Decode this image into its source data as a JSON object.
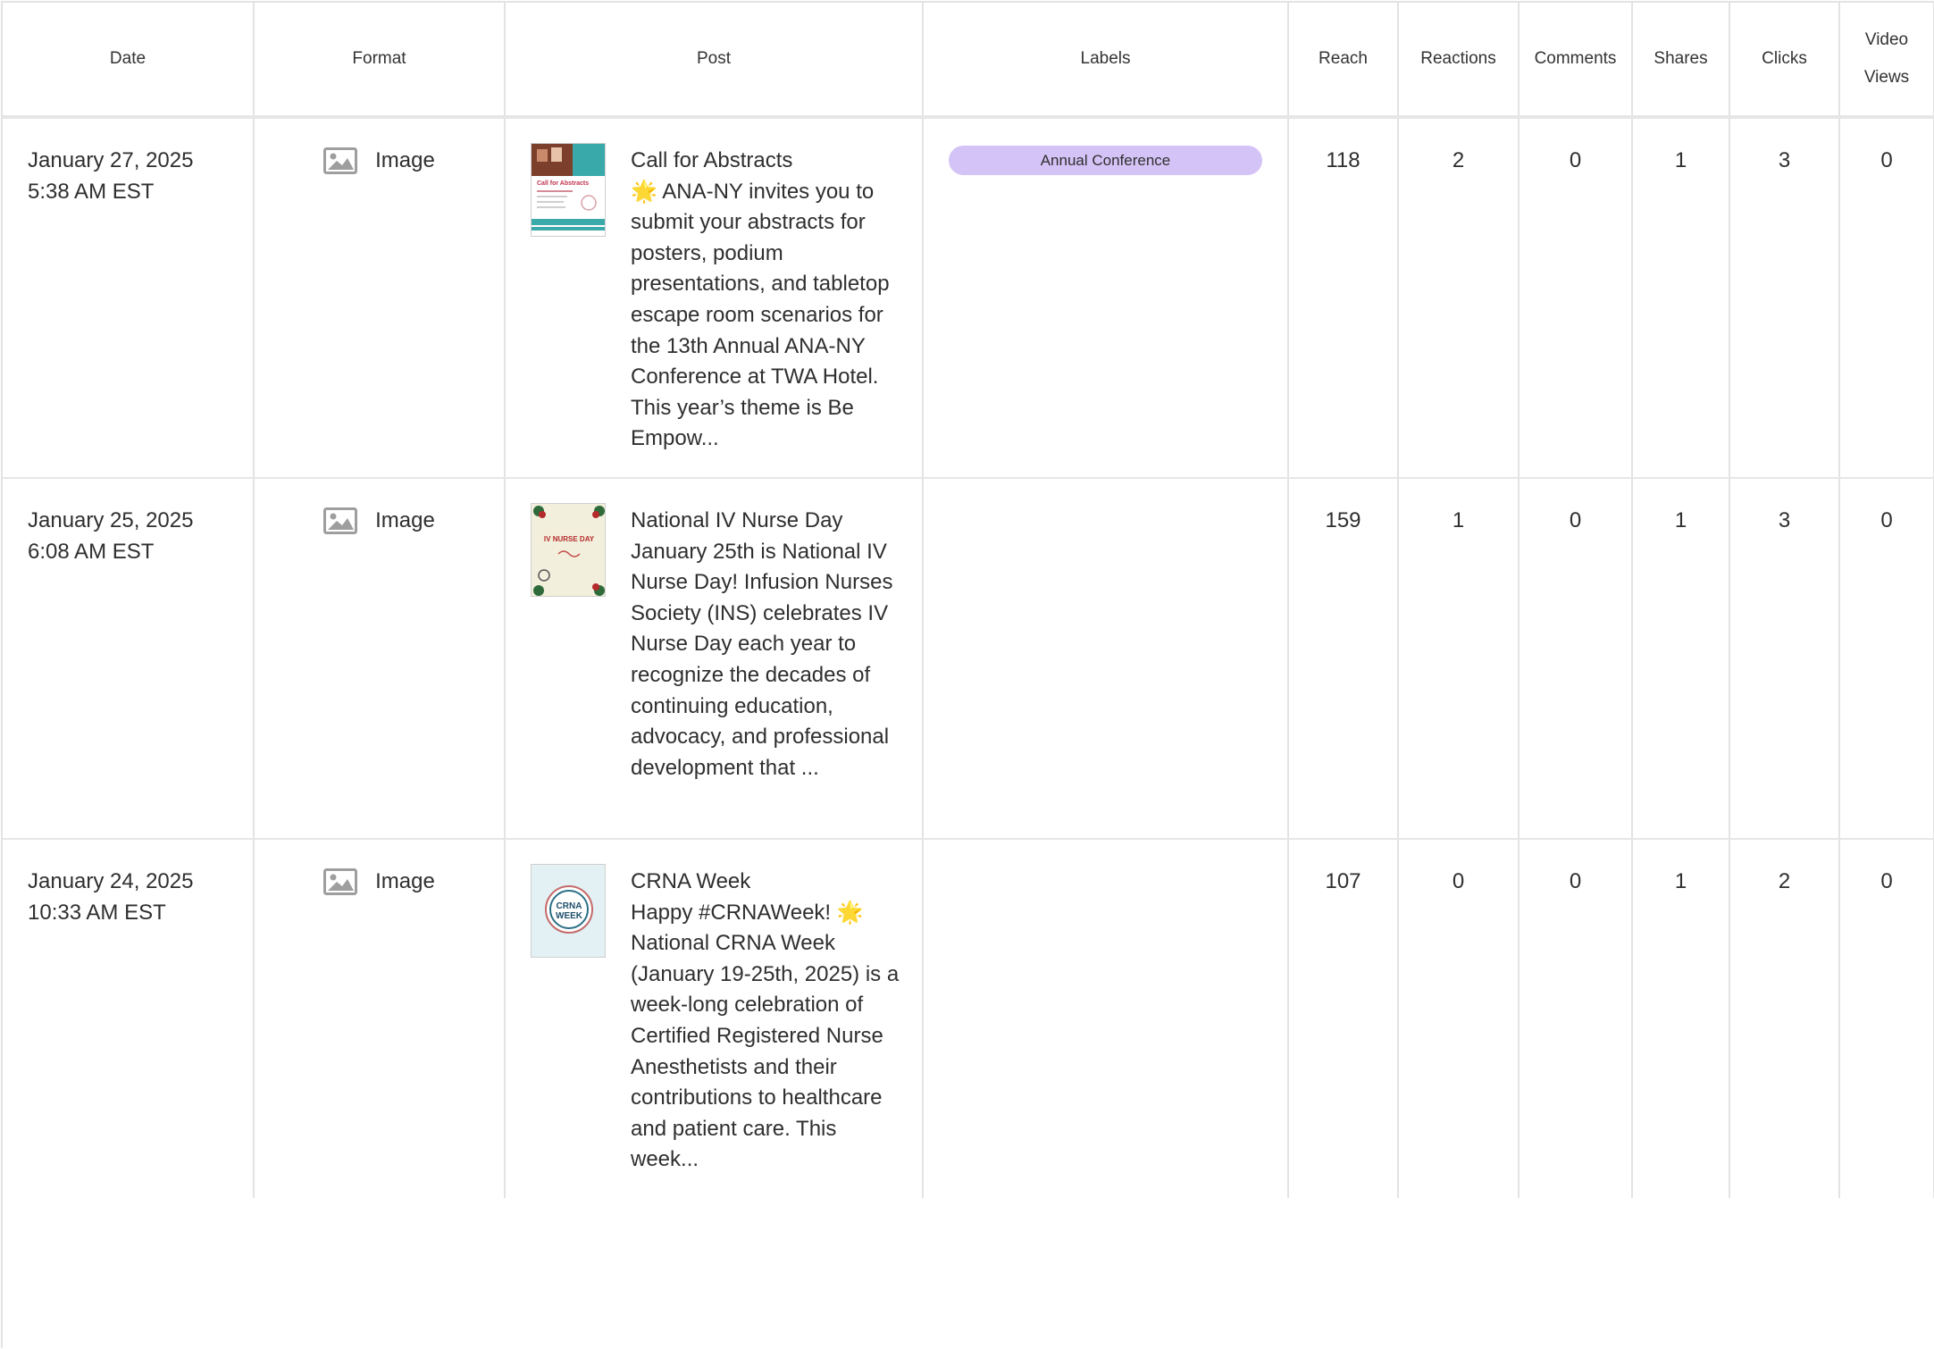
{
  "columns": {
    "date": "Date",
    "format": "Format",
    "post": "Post",
    "labels": "Labels",
    "reach": "Reach",
    "reactions": "Reactions",
    "comments": "Comments",
    "shares": "Shares",
    "clicks": "Clicks",
    "video_views_line1": "Video",
    "video_views_line2": "Views"
  },
  "colors": {
    "label_pill": "#d4c3f6",
    "grid": "#e3e3e3"
  },
  "rows": [
    {
      "date": "January 27, 2025",
      "time": "5:38 AM EST",
      "format": "Image",
      "format_icon": "image-icon",
      "thumbnail": "call-for-abstracts-flyer",
      "post_title": "Call for Abstracts",
      "post_body": "🌟 ANA-NY invites you to submit your abstracts for posters, podium presentations, and tabletop escape room scenarios for the 13th Annual ANA-NY Conference at TWA Hotel. This year’s theme is Be Empow...",
      "label": "Annual Conference",
      "reach": "118",
      "reactions": "2",
      "comments": "0",
      "shares": "1",
      "clicks": "3",
      "video_views": "0"
    },
    {
      "date": "January 25, 2025",
      "time": "6:08 AM EST",
      "format": "Image",
      "format_icon": "image-icon",
      "thumbnail": "iv-nurse-day-card",
      "post_title": "National IV Nurse Day",
      "post_body": "January 25th is National IV Nurse Day! Infusion Nurses Society (INS) celebrates IV Nurse Day each year to recognize the decades of continuing education, advocacy, and professional development that ...",
      "label": "",
      "reach": "159",
      "reactions": "1",
      "comments": "0",
      "shares": "1",
      "clicks": "3",
      "video_views": "0"
    },
    {
      "date": "January 24, 2025",
      "time": "10:33 AM EST",
      "format": "Image",
      "format_icon": "image-icon",
      "thumbnail": "crna-week-badge",
      "post_title": "CRNA Week",
      "post_body": "Happy #CRNAWeek! 🌟 National CRNA Week (January 19-25th, 2025) is a week-long celebration of Certified Registered Nurse Anesthetists and their contributions to healthcare and patient care. This week...",
      "label": "",
      "reach": "107",
      "reactions": "0",
      "comments": "0",
      "shares": "1",
      "clicks": "2",
      "video_views": "0"
    }
  ],
  "thumbnails": {
    "abstracts_title": "Call for Abstracts",
    "iv_title": "IV NURSE DAY",
    "crna_line1": "CRNA",
    "crna_line2": "WEEK"
  }
}
